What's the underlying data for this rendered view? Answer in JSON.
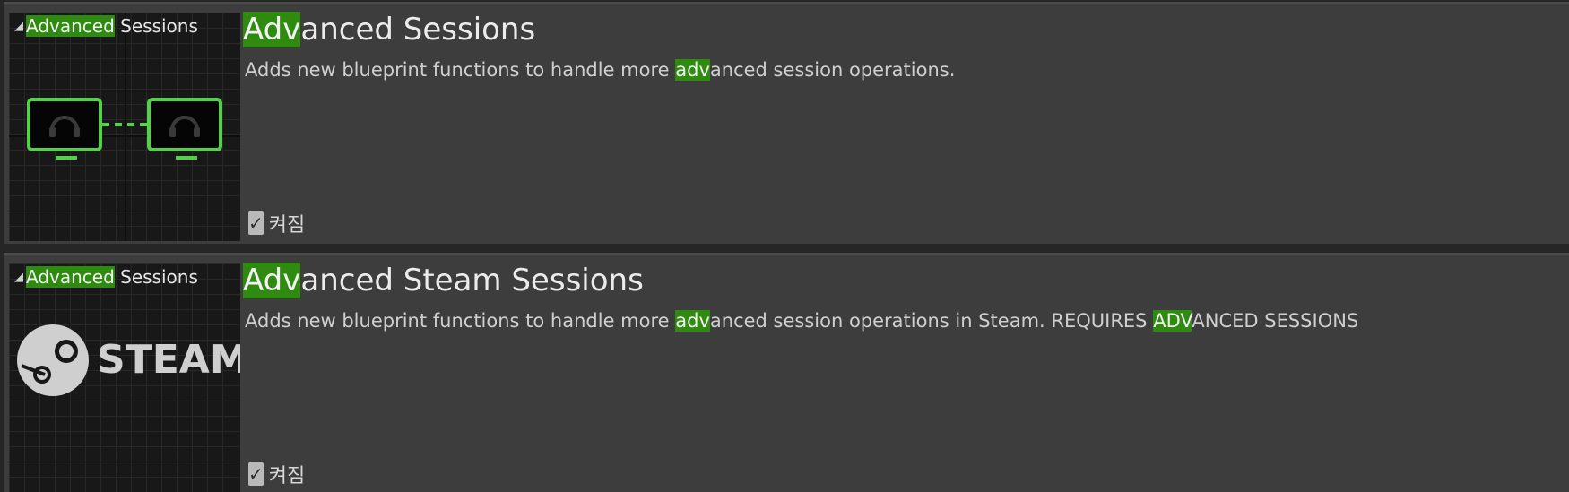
{
  "plugins": [
    {
      "category_hl": "Advanced",
      "category_rest": " Sessions",
      "title_hl": "Adv",
      "title_rest": "anced Sessions",
      "desc_pre": "Adds new blueprint functions to handle more ",
      "desc_hl": "adv",
      "desc_post": "anced session operations.",
      "enabled_label": "켜짐",
      "icon": "multiplayer-sessions-icon"
    },
    {
      "category_hl": "Advanced",
      "category_rest": " Sessions",
      "title_hl": "Adv",
      "title_rest": "anced Steam Sessions",
      "desc_pre": "Adds new blueprint functions to handle more ",
      "desc_hl": "adv",
      "desc_mid": "anced session operations in Steam. REQUIRES ",
      "desc_hl2": "ADV",
      "desc_post": "ANCED SESSIONS",
      "logo_text": "STEAM",
      "enabled_label": "켜짐",
      "icon": "steam-logo"
    }
  ],
  "colors": {
    "highlight": "#2f8a10",
    "card_bg": "#3d3d3d",
    "thumb_bg": "#181818",
    "icon_green": "#55d04a"
  }
}
